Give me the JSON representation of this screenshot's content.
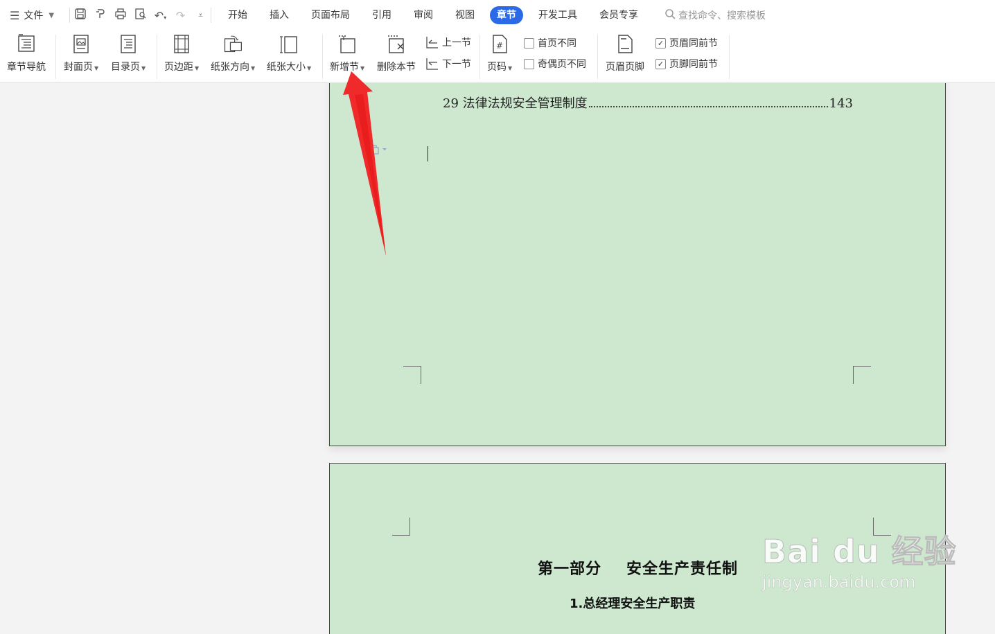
{
  "menubar": {
    "file_label": "文件",
    "tabs": [
      {
        "label": "开始"
      },
      {
        "label": "插入"
      },
      {
        "label": "页面布局"
      },
      {
        "label": "引用"
      },
      {
        "label": "审阅"
      },
      {
        "label": "视图"
      },
      {
        "label": "章节",
        "active": true
      },
      {
        "label": "开发工具"
      },
      {
        "label": "会员专享"
      }
    ],
    "search_placeholder": "查找命令、搜索模板",
    "accent_color": "#2a6ae6"
  },
  "ribbon": {
    "chapter_nav": "章节导航",
    "cover_page": "封面页",
    "toc_page": "目录页",
    "margins": "页边距",
    "orientation": "纸张方向",
    "paper_size": "纸张大小",
    "new_section": "新增节",
    "delete_section": "删除本节",
    "prev_section": "上一节",
    "next_section": "下一节",
    "page_number": "页码",
    "first_page_diff": {
      "label": "首页不同",
      "checked": false
    },
    "odd_even_diff": {
      "label": "奇偶页不同",
      "checked": false
    },
    "header_footer": "页眉页脚",
    "header_same": {
      "label": "页眉同前节",
      "checked": true
    },
    "footer_same": {
      "label": "页脚同前节",
      "checked": true
    }
  },
  "document": {
    "toc_entry": {
      "text": "29 法律法规安全管理制度",
      "page": "143"
    },
    "page2_heading": {
      "part": "第一部分",
      "title": "安全生产责任制"
    },
    "page2_subheading": "1.总经理安全生产职责",
    "page_color": "#cde8cf"
  },
  "watermark": {
    "brand": "Bai du 经验",
    "url": "jingyan.baidu.com"
  },
  "annotation_color": "#f02a2a"
}
